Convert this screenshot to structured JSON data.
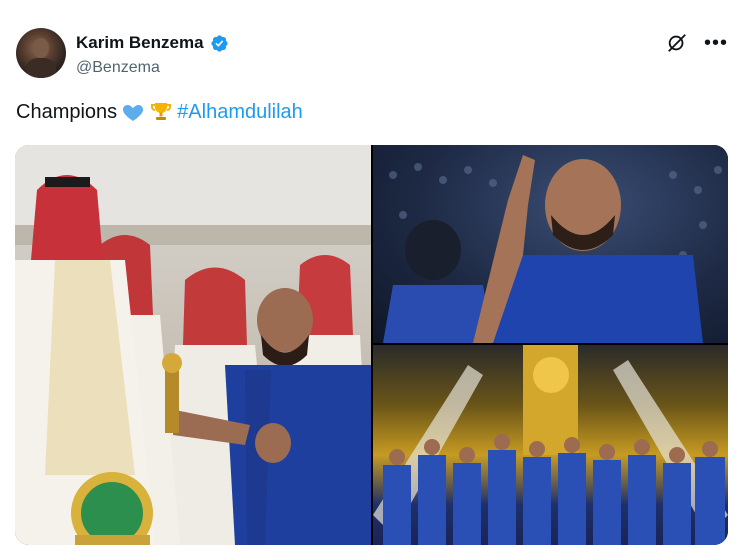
{
  "user": {
    "name": "Karim Benzema",
    "handle": "@Benzema"
  },
  "tweet": {
    "text": "Champions",
    "hashtag": "#Alhamdulilah"
  },
  "icons": {
    "verified": "verified-badge-icon",
    "grok": "grok-icon",
    "more": "more-options-icon",
    "heart": "blue-heart-emoji",
    "trophy": "trophy-emoji"
  },
  "colors": {
    "accent": "#1d9bf0",
    "secondary_text": "#536471"
  },
  "media": {
    "images": [
      {
        "label": "trophy-presentation-photo"
      },
      {
        "label": "benzema-celebrating-photo"
      },
      {
        "label": "team-celebration-photo"
      }
    ]
  }
}
